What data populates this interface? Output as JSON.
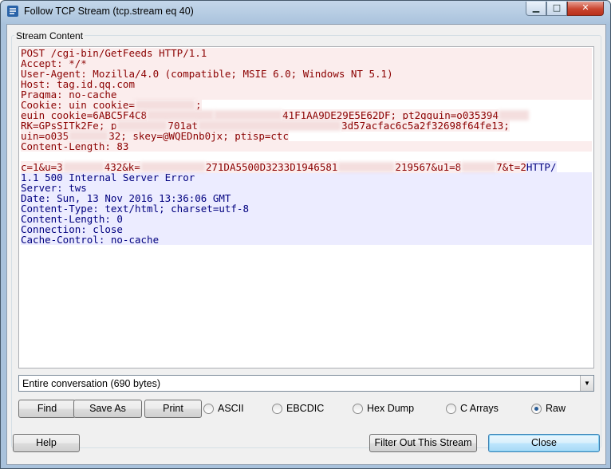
{
  "window": {
    "title": "Follow TCP Stream (tcp.stream eq 40)",
    "minimize_glyph": "▁",
    "maximize_glyph": "□",
    "close_glyph": "✕"
  },
  "group_label": "Stream Content",
  "stream": {
    "client_lines": [
      "POST /cgi-bin/GetFeeds HTTP/1.1",
      "Accept: */*",
      "User-Agent: Mozilla/4.0 (compatible; MSIE 6.0; Windows NT 5.1)",
      "Host: tag.id.qq.com",
      "Pragma: no-cache"
    ],
    "cookie_prefix": "Cookie: uin_cookie=",
    "cookie_suffix": ";",
    "euin_prefix": "euin_cookie=6ABC5F4C8",
    "euin_mid": "41F1AA9DE29E5E62DF; pt2gguin=o035394",
    "rk_prefix": "RK=GPsSITk2Fe; p",
    "rk_mid": "701at",
    "rk_suffix": "3d57acfac6c5a2f32698f64fe13;",
    "uin_prefix": "uin=o035",
    "uin_mid": "32; skey=@WQEDnb0jx; ptisp=ctc",
    "content_length": "Content-Length: 83",
    "body_a": "c=1&u=3",
    "body_b": "432&k=",
    "body_c": "271DA5500D3233D1946581",
    "body_d": "219567&u1=8",
    "body_e": "7&t=2",
    "server_first": "HTTP/",
    "server_lines": [
      "1.1 500 Internal Server Error",
      "Server: tws",
      "Date: Sun, 13 Nov 2016 13:36:06 GMT",
      "Content-Type: text/html; charset=utf-8",
      "Content-Length: 0",
      "Connection: close",
      "Cache-Control: no-cache"
    ]
  },
  "conversation_select": {
    "selected": "Entire conversation (690 bytes)",
    "arrow_glyph": "▼"
  },
  "buttons": {
    "find": "Find",
    "save_as": "Save As",
    "print": "Print",
    "help": "Help",
    "filter_out": "Filter Out This Stream",
    "close": "Close"
  },
  "format_options": [
    {
      "label": "ASCII",
      "checked": false
    },
    {
      "label": "EBCDIC",
      "checked": false
    },
    {
      "label": "Hex Dump",
      "checked": false
    },
    {
      "label": "C Arrays",
      "checked": false
    },
    {
      "label": "Raw",
      "checked": true
    }
  ],
  "colors": {
    "client_text": "#8b0000",
    "server_text": "#00007f"
  }
}
